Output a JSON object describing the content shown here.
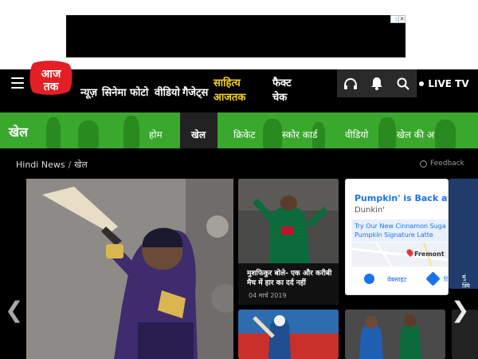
{
  "ad": {
    "choices_label": "▷",
    "close_label": "✕"
  },
  "header": {
    "logo_text": "आज तक",
    "nav": [
      "न्यूज़",
      "सिनेमा",
      "फोटो",
      "वीडियो",
      "गैजेट्स"
    ],
    "nav_highlight": {
      "line1": "साहित्य",
      "line2": "आजतक",
      "color": "#f5d21e"
    },
    "nav_factcheck": {
      "line1": "फैक्ट",
      "line2": "चेक"
    },
    "icons": [
      "headphones-icon",
      "bell-icon",
      "search-icon"
    ],
    "live_tv_label": "LIVE TV"
  },
  "section": {
    "title": "खेल",
    "tabs": [
      "होम",
      "खेल",
      "क्रिकेट",
      "स्कोर कार्ड",
      "वीडियो",
      "खेल की अ"
    ],
    "active_tab": "खेल",
    "color": "#3aa82d"
  },
  "breadcrumb": {
    "home": "Hindi News",
    "current": "खेल"
  },
  "feedback_label": "Feedback",
  "cards": {
    "card1_title": "मुशफिकुर बोले- एक और करीबी मैच में हार का दर्द नहीं",
    "card1_date": "04 मार्च 2019"
  },
  "sponsored": {
    "title": "Pumpkin' is Back at Dunkin",
    "brand": "Dunkin'",
    "promo_line1": "Try Our New Cinnamon Suga",
    "promo_line2": "Pumpkin Signature Latte",
    "map_label": "Fremont",
    "website_label": "वेबसाइट",
    "directions_label": "दि"
  },
  "peek_text": "मुं\nस्मि",
  "carousel": {
    "prev_label": "❮",
    "next_label": "❯"
  }
}
